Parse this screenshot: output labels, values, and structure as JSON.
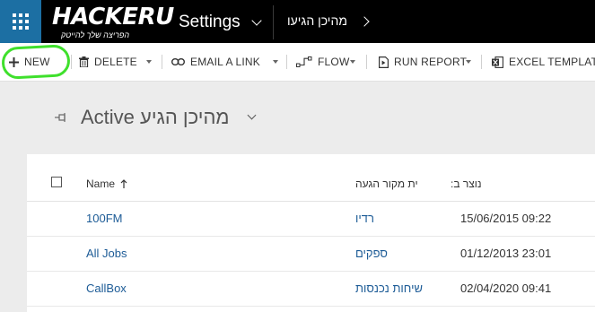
{
  "nav": {
    "logo_text": "HACKERU",
    "logo_tagline": "הפריצה שלך להייטק",
    "area_label": "Settings",
    "breadcrumb": "מהיכן הגיעו"
  },
  "commands": {
    "new": "NEW",
    "delete": "DELETE",
    "email_link": "EMAIL A LINK",
    "flow": "FLOW",
    "run_report": "RUN REPORT",
    "excel_templates": "EXCEL TEMPLATES"
  },
  "view": {
    "title": "Active מהיכן הגיע"
  },
  "grid": {
    "columns": {
      "name": "Name",
      "source": "ית מקור הגעה",
      "created": "נוצר ב:"
    },
    "rows": [
      {
        "name": "100FM",
        "source": "רדיו",
        "created": "15/06/2015 09:22"
      },
      {
        "name": "All Jobs",
        "source": "ספקים",
        "created": "01/12/2013 23:01"
      },
      {
        "name": "CallBox",
        "source": "שיחות נכנסות",
        "created": "02/04/2020 09:41"
      }
    ]
  },
  "colors": {
    "nav_bg": "#000000",
    "waffle_bg": "#1c6fa3",
    "link": "#1c5b96",
    "highlight": "#3fe02c",
    "page_bg": "#ececec"
  }
}
